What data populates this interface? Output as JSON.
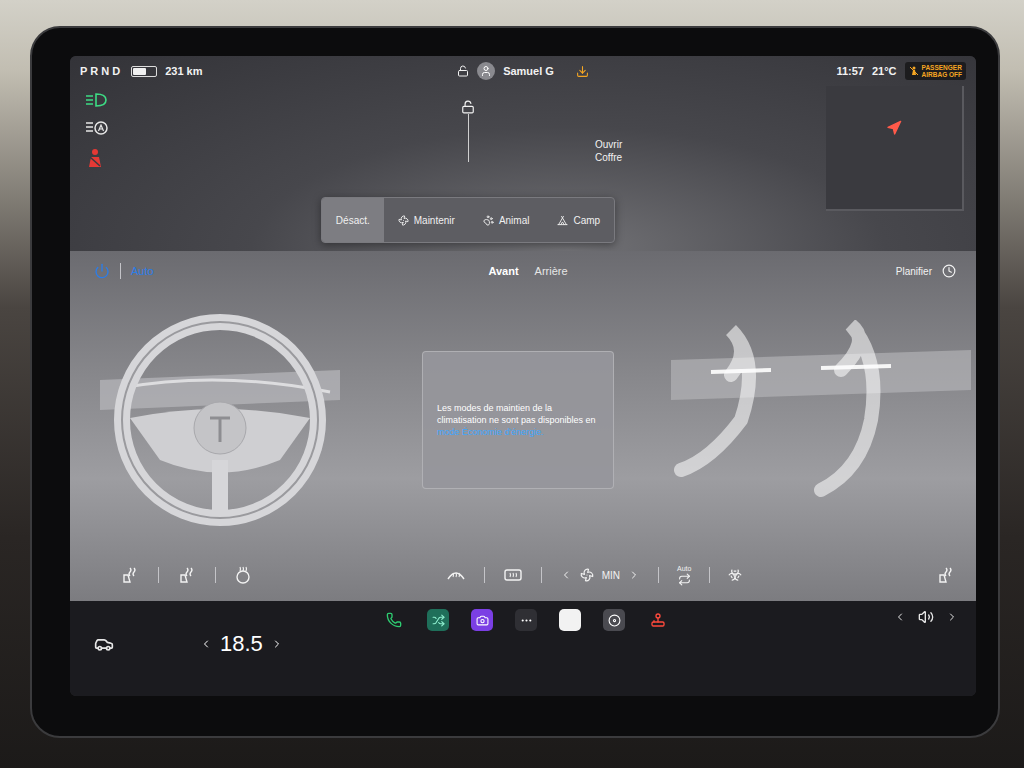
{
  "status_bar": {
    "gears": "PRND",
    "battery": {
      "level": 0.6,
      "range": "231 km"
    },
    "user": "Samuel G",
    "time": "11:57",
    "temperature": "21°C",
    "airbag_badge": {
      "line1": "PASSENGER",
      "line2": "AIRBAG OFF"
    }
  },
  "indicators": [
    {
      "kind": "headlights",
      "color": "#3ddc84"
    },
    {
      "kind": "auto-high-beam",
      "color": "#e6e6e6"
    },
    {
      "kind": "seatbelt",
      "color": "#e53935"
    }
  ],
  "trunk": {
    "label": "Ouvrir Coffre"
  },
  "keep_modes": [
    {
      "kind": "off",
      "label": "Désact.",
      "selected": true
    },
    {
      "kind": "fan",
      "label": "Maintenir",
      "selected": false
    },
    {
      "kind": "pet",
      "label": "Animal",
      "selected": false
    },
    {
      "kind": "camp",
      "label": "Camp",
      "selected": false
    }
  ],
  "climate": {
    "power_on": true,
    "mode": "Auto",
    "zones": [
      {
        "label": "Avant",
        "selected": true
      },
      {
        "label": "Arrière",
        "selected": false
      }
    ],
    "schedule": "Planifier",
    "message": {
      "text": "Les modes de maintien de la climatisation ne sont pas disponibles en",
      "link": "mode Économie d'énergie."
    },
    "fan": "MIN",
    "recirculation": "Auto"
  },
  "bottom_bar": {
    "temperature": "18.5"
  }
}
